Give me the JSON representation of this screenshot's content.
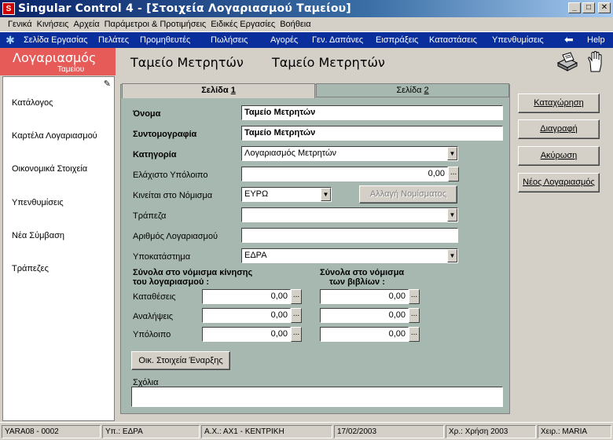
{
  "window": {
    "title": "Singular Control 4 - [Στοιχεία Λογαριασμού Ταμείου]",
    "icon_letter": "S"
  },
  "menu": [
    {
      "label": "Γενικά"
    },
    {
      "label": "Κινήσεις"
    },
    {
      "label": "Αρχεία"
    },
    {
      "label": "Παράμετροι & Προτιμήσεις"
    },
    {
      "label": "Ειδικές Εργασίες"
    },
    {
      "label": "Βοήθεια"
    }
  ],
  "nav": [
    {
      "label": "Σελίδα Εργασίας"
    },
    {
      "label": "Πελάτες"
    },
    {
      "label": "Προμηθευτές"
    },
    {
      "label": "Πωλήσεις"
    },
    {
      "label": "Αγορές"
    },
    {
      "label": "Γεν. Δαπάνες"
    },
    {
      "label": "Εισπράξεις"
    },
    {
      "label": "Καταστάσεις"
    },
    {
      "label": "Υπενθυμίσεις"
    }
  ],
  "nav_help": "Help",
  "header": {
    "section_title": "Λογαριασμός",
    "section_subtitle": "Ταμείου",
    "name1": "Ταμείο Μετρητών",
    "name2": "Ταμείο Μετρητών"
  },
  "sidebar": [
    {
      "label": "Κατάλογος"
    },
    {
      "label": "Καρτέλα Λογαριασμού"
    },
    {
      "label": "Οικονομικά Στοιχεία"
    },
    {
      "label": "Υπενθυμίσεις"
    },
    {
      "label": "Νέα Σύμβαση"
    },
    {
      "label": "Τράπεζες"
    }
  ],
  "tabs": {
    "page1_text": "Σελίδα ",
    "page1_num": "1",
    "page2_text": "Σελίδα ",
    "page2_num": "2"
  },
  "form": {
    "name_label": "Όνομα",
    "name_value": "Ταμείο Μετρητών",
    "short_label": "Συντομογραφία",
    "short_value": "Ταμείο Μετρητών",
    "category_label": "Κατηγορία",
    "category_value": "Λογαριασμός Μετρητών",
    "min_balance_label": "Ελάχιστο Υπόλοιπο",
    "min_balance_value": "0,00",
    "currency_label": "Κινείται στο Νόμισμα",
    "currency_value": "ΕΥΡΩ",
    "change_currency_label": "Αλλαγή Νομίσματος",
    "bank_label": "Τράπεζα",
    "bank_value": "",
    "account_no_label": "Αριθμός Λογαριασμού",
    "account_no_value": "",
    "branch_label": "Υποκατάστημα",
    "branch_value": "ΕΔΡΑ",
    "totals_move_line1": "Σύνολα στο νόμισμα κίνησης",
    "totals_move_line2": "του λογαριασμού :",
    "totals_books_line1": "Σύνολα στο νόμισμα",
    "totals_books_line2": "των βιβλίων :",
    "deposits_label": "Καταθέσεις",
    "withdrawals_label": "Αναλήψεις",
    "balance_label": "Υπόλοιπο",
    "move_deposits": "0,00",
    "move_withdrawals": "0,00",
    "move_balance": "0,00",
    "books_deposits": "0,00",
    "books_withdrawals": "0,00",
    "books_balance": "0,00",
    "opening_button": "Οικ. Στοιχεία Έναρξης",
    "notes_label": "Σχόλια"
  },
  "actions": {
    "save": "Καταχώρηση",
    "delete": "Διαγραφή",
    "cancel": "Ακύρωση",
    "new_account": "Νέος Λογαριασμός"
  },
  "status": {
    "db": "YARA08 - 0002",
    "branch": "Υπ.: ΕΔΡΑ",
    "ax": "Α.Χ.: ΑΧ1 - ΚΕΝΤΡΙΚΗ",
    "date": "17/02/2003",
    "year": "Χρ.: Χρήση 2003",
    "user": "Χειρ.: MARIA"
  }
}
